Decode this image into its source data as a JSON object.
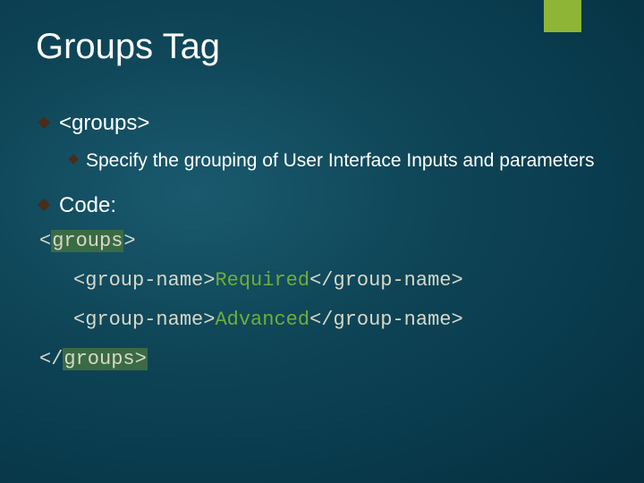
{
  "accent_color": "#8fb536",
  "title": "Groups Tag",
  "bullets": {
    "item1": "<groups>",
    "item1_sub": "Specify the grouping of User Interface Inputs and parameters",
    "item2": "Code:"
  },
  "code": {
    "open_tag_hl": "groups",
    "line1_open": "<group-name>",
    "line1_val": "Required",
    "line1_close": "</group-name>",
    "line2_open": "<group-name>",
    "line2_val": "Advanced",
    "line2_close": "</group-name>",
    "close_tag_pre": "</",
    "close_tag_hl": "groups>",
    "lt": "<",
    "gt": ">"
  }
}
